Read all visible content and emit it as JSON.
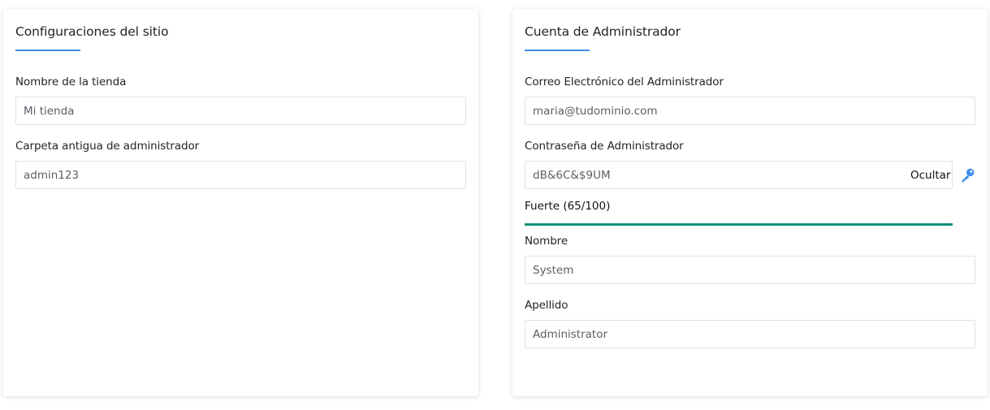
{
  "site_settings": {
    "title": "Configuraciones del sitio",
    "fields": [
      {
        "label": "Nombre de la tienda",
        "value": "Mi tienda"
      },
      {
        "label": "Carpeta antigua de administrador",
        "value": "admin123"
      }
    ]
  },
  "admin_account": {
    "title": "Cuenta de Administrador",
    "email": {
      "label": "Correo Electrónico del Administrador",
      "value": "maria@tudominio.com"
    },
    "password": {
      "label": "Contraseña de Administrador",
      "value": "dB&6C&$9UM",
      "toggle_label": "Ocultar",
      "strength_text": "Fuerte (65/100)",
      "strength_score": 100,
      "strength_color": "#0f8f7a",
      "generate_icon": "key-icon"
    },
    "first_name": {
      "label": "Nombre",
      "value": "System"
    },
    "last_name": {
      "label": "Apellido",
      "value": "Administrator"
    }
  },
  "colors": {
    "accent": "#3f8fe8",
    "strength": "#0f8f7a",
    "input_border": "#dee2e6"
  }
}
